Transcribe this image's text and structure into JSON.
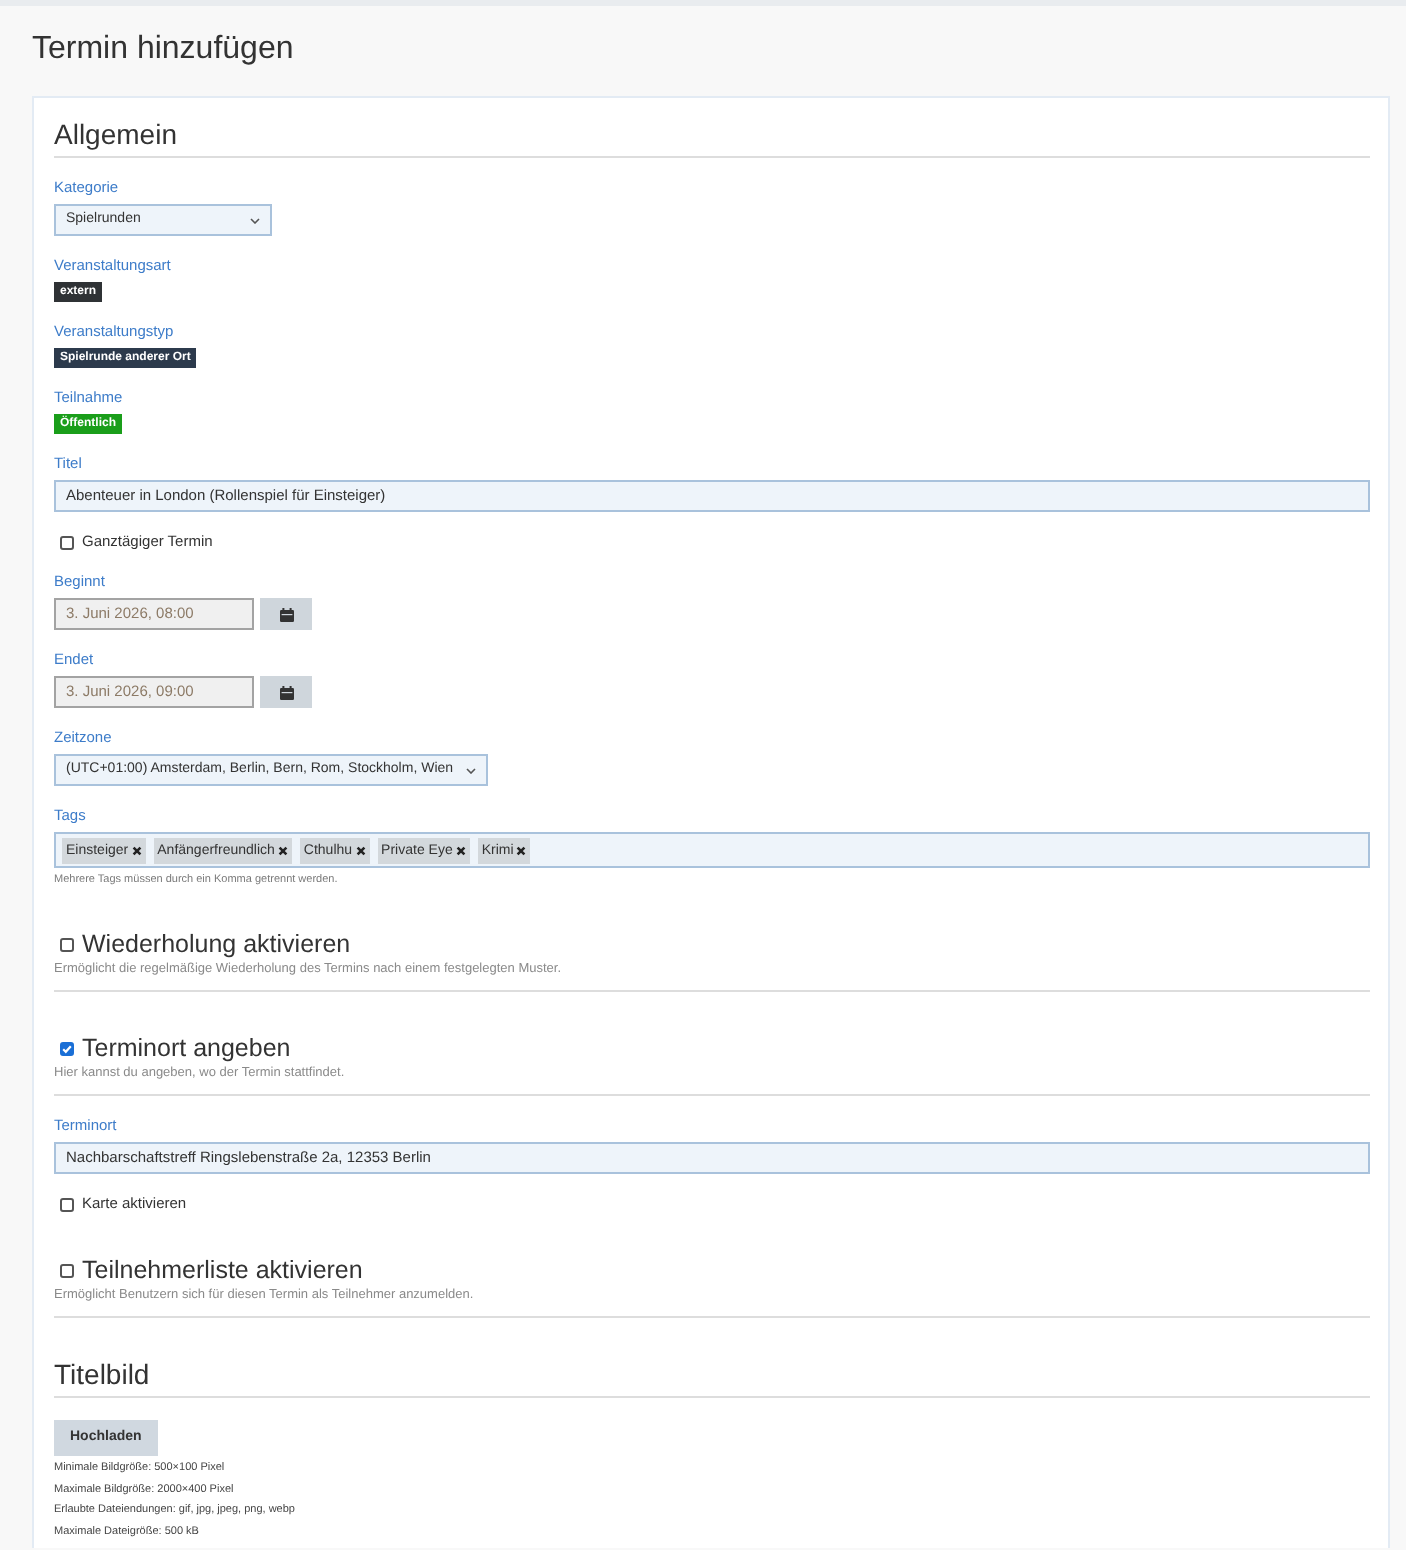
{
  "page": {
    "title": "Termin hinzufügen"
  },
  "sections": [
    {
      "kind": "heading",
      "title": "Allgemein",
      "fields": [
        {
          "kind": "select",
          "label": "Kategorie",
          "value": "Spielrunden"
        },
        {
          "kind": "badge",
          "label": "Veranstaltungsart",
          "text": "extern",
          "color": "#2f3235"
        },
        {
          "kind": "badge",
          "label": "Veranstaltungstyp",
          "text": "Spielrunde anderer Ort",
          "color": "#2c3a4c"
        },
        {
          "kind": "badge",
          "label": "Teilnahme",
          "text": "Öffentlich",
          "color": "#1a9e1a"
        },
        {
          "kind": "text",
          "label": "Titel",
          "value": "Abenteuer in London (Rollenspiel für Einsteiger)"
        },
        {
          "kind": "checkbox",
          "label": "Ganztägiger Termin",
          "checked": false
        },
        {
          "kind": "datetime",
          "label": "Beginnt",
          "value": "3. Juni 2026, 08:00"
        },
        {
          "kind": "datetime",
          "label": "Endet",
          "value": "3. Juni 2026, 09:00"
        },
        {
          "kind": "select",
          "label": "Zeitzone",
          "value": "(UTC+01:00) Amsterdam, Berlin, Bern, Rom, Stockholm, Wien"
        },
        {
          "kind": "tags",
          "label": "Tags",
          "tags": [
            "Einsteiger",
            "Anfängerfreundlich",
            "Cthulhu",
            "Private Eye",
            "Krimi"
          ],
          "help": "Mehrere Tags müssen durch ein Komma getrennt werden."
        }
      ]
    },
    {
      "kind": "toggle",
      "title": "Wiederholung aktivieren",
      "checked": false,
      "description": "Ermöglicht die regelmäßige Wiederholung des Termins nach einem festgelegten Muster."
    },
    {
      "kind": "toggle",
      "title": "Terminort angeben",
      "checked": true,
      "description": "Hier kannst du angeben, wo der Termin stattfindet.",
      "fields": [
        {
          "kind": "text",
          "label": "Terminort",
          "value": "Nachbarschaftstreff Ringslebenstraße 2a, 12353 Berlin"
        },
        {
          "kind": "checkbox",
          "label": "Karte aktivieren",
          "checked": false
        }
      ]
    },
    {
      "kind": "toggle",
      "title": "Teilnehmerliste aktivieren",
      "checked": false,
      "description": "Ermöglicht Benutzern sich für diesen Termin als Teilnehmer anzumelden."
    },
    {
      "kind": "heading",
      "title": "Titelbild",
      "fields": [
        {
          "kind": "upload",
          "button": "Hochladen",
          "notes": [
            "Minimale Bildgröße: 500×100 Pixel",
            "Maximale Bildgröße: 2000×400 Pixel",
            "Erlaubte Dateiendungen: gif, jpg, jpeg, png, webp",
            "Maximale Dateigröße: 500 kB"
          ]
        }
      ]
    }
  ]
}
